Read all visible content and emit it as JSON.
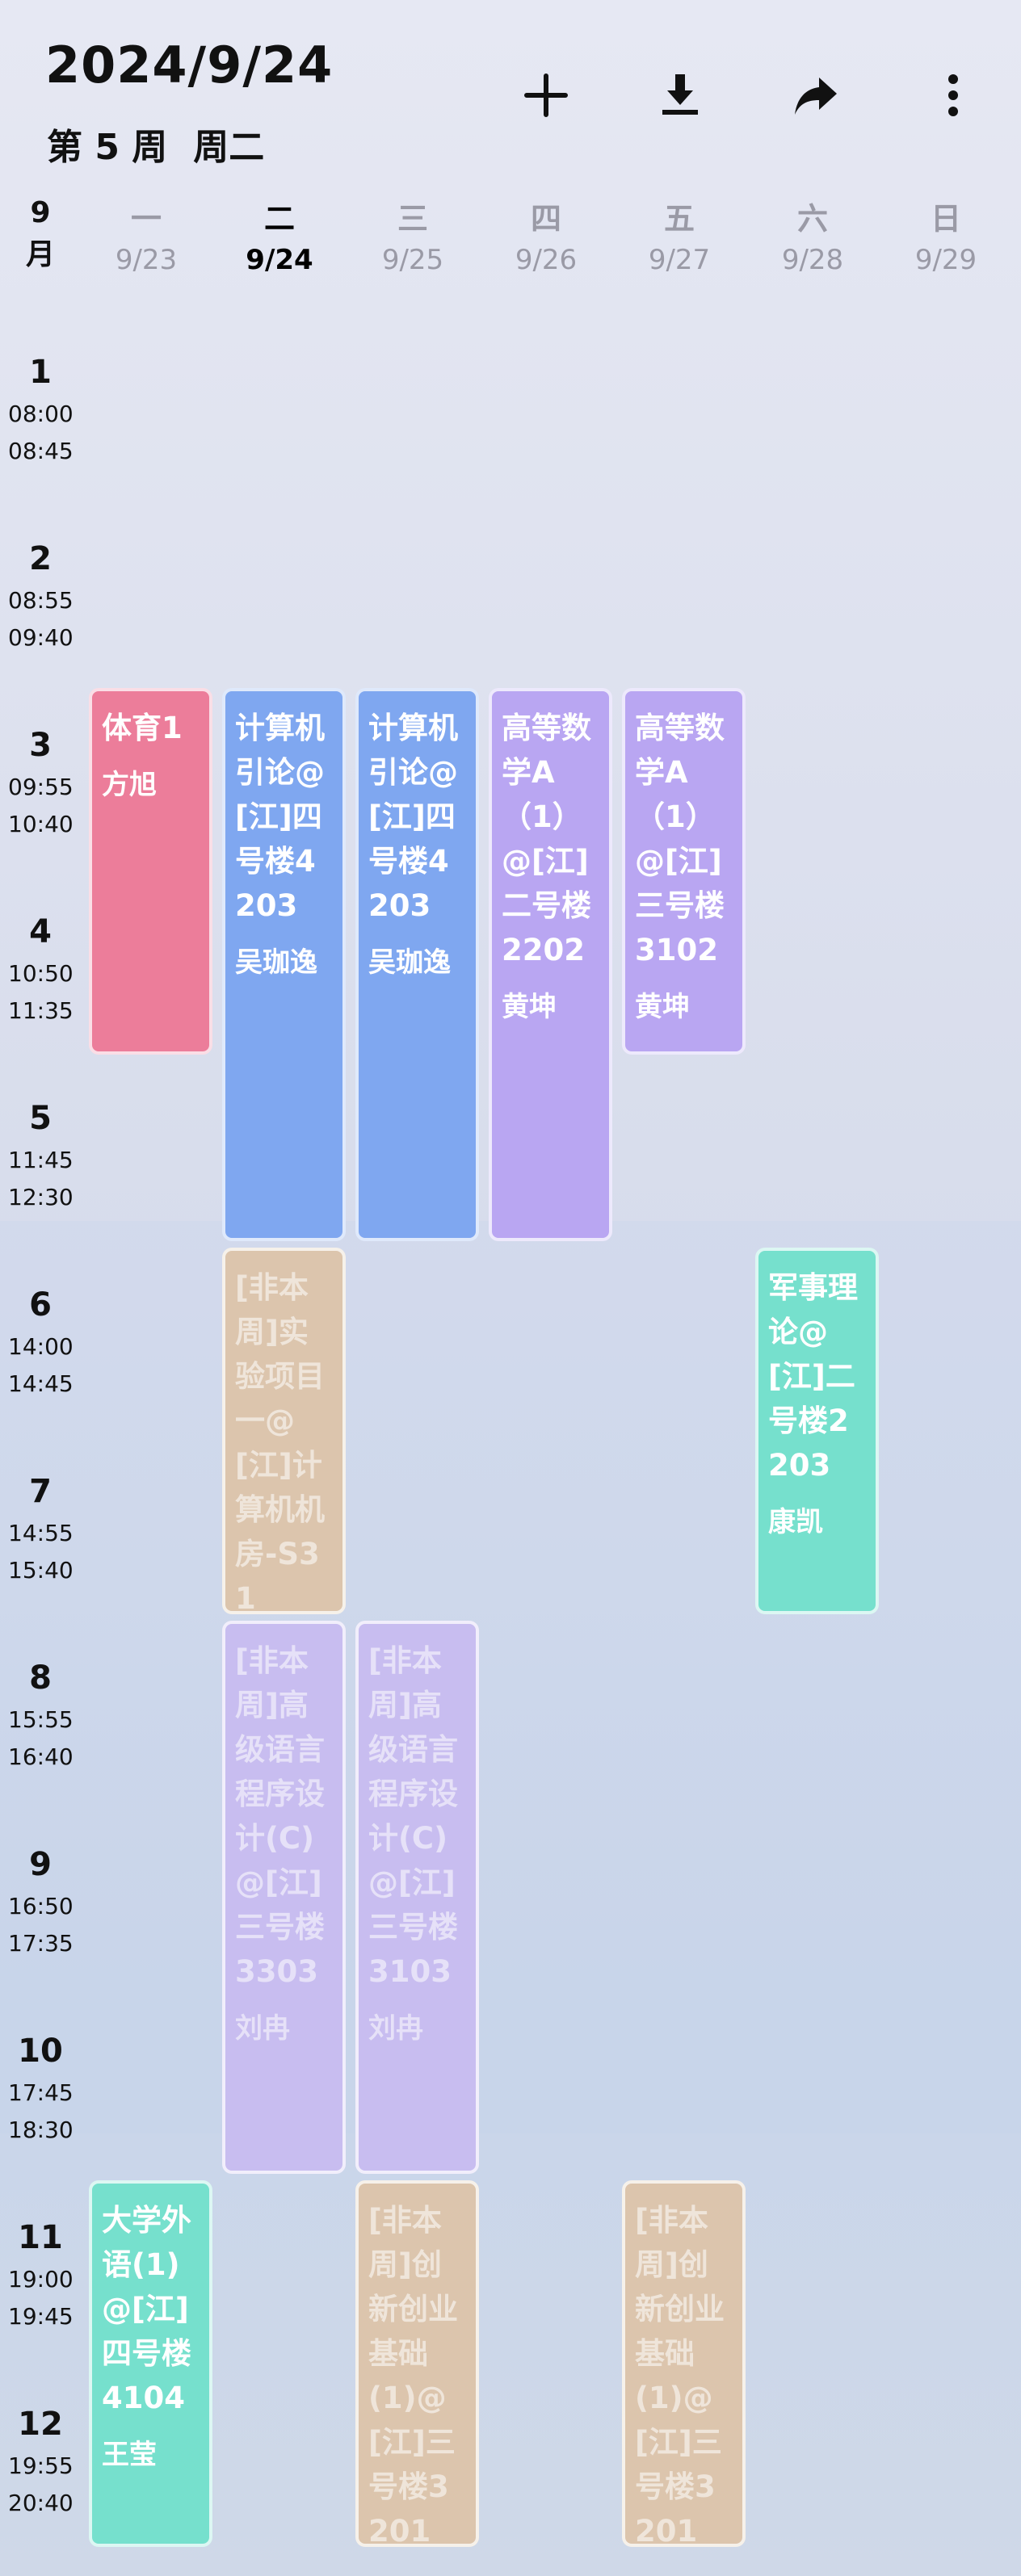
{
  "header": {
    "date": "2024/9/24",
    "week": "第 5 周",
    "weekday": "周二"
  },
  "toolbar": {
    "add_icon": "plus-icon",
    "download_icon": "download-icon",
    "share_icon": "share-icon",
    "more_icon": "more-vertical-icon"
  },
  "calendar": {
    "month_label": "9\n月",
    "days": [
      {
        "weekday": "一",
        "date": "9/23"
      },
      {
        "weekday": "二",
        "date": "9/24",
        "today": true
      },
      {
        "weekday": "三",
        "date": "9/25"
      },
      {
        "weekday": "四",
        "date": "9/26"
      },
      {
        "weekday": "五",
        "date": "9/27"
      },
      {
        "weekday": "六",
        "date": "9/28"
      },
      {
        "weekday": "日",
        "date": "9/29"
      }
    ],
    "periods": [
      {
        "num": "1",
        "start": "08:00",
        "end": "08:45"
      },
      {
        "num": "2",
        "start": "08:55",
        "end": "09:40"
      },
      {
        "num": "3",
        "start": "09:55",
        "end": "10:40"
      },
      {
        "num": "4",
        "start": "10:50",
        "end": "11:35"
      },
      {
        "num": "5",
        "start": "11:45",
        "end": "12:30"
      },
      {
        "num": "6",
        "start": "14:00",
        "end": "14:45"
      },
      {
        "num": "7",
        "start": "14:55",
        "end": "15:40"
      },
      {
        "num": "8",
        "start": "15:55",
        "end": "16:40"
      },
      {
        "num": "9",
        "start": "16:50",
        "end": "17:35"
      },
      {
        "num": "10",
        "start": "17:45",
        "end": "18:30"
      },
      {
        "num": "11",
        "start": "19:00",
        "end": "19:45"
      },
      {
        "num": "12",
        "start": "19:55",
        "end": "20:40"
      }
    ]
  },
  "courses": [
    {
      "day": 0,
      "start": 3,
      "end": 4,
      "name": "体育1",
      "teacher": "方旭",
      "color": "#ec7d9a",
      "current_week": true
    },
    {
      "day": 1,
      "start": 3,
      "end": 5,
      "name": "计算机引论@[江]四号楼4203",
      "teacher": "吴珈逸",
      "color": "#7fa7f0",
      "current_week": true
    },
    {
      "day": 2,
      "start": 3,
      "end": 5,
      "name": "计算机引论@[江]四号楼4203",
      "teacher": "吴珈逸",
      "color": "#7fa7f0",
      "current_week": true
    },
    {
      "day": 3,
      "start": 3,
      "end": 5,
      "name": "高等数学A（1）@[江]二号楼2202",
      "teacher": "黄坤",
      "color": "#b9a6f2",
      "current_week": true
    },
    {
      "day": 4,
      "start": 3,
      "end": 4,
      "name": "高等数学A（1）@[江]三号楼3102",
      "teacher": "黄坤",
      "color": "#b9a6f2",
      "current_week": true
    },
    {
      "day": 1,
      "start": 6,
      "end": 7,
      "name": "[非本周]实验项目一@[江]计算机机房-S31",
      "teacher": "",
      "color": "#dcc5ad",
      "current_week": false
    },
    {
      "day": 5,
      "start": 6,
      "end": 7,
      "name": "军事理论@[江]二号楼2203",
      "teacher": "康凯",
      "color": "#76e0cd",
      "current_week": true
    },
    {
      "day": 1,
      "start": 8,
      "end": 10,
      "name": "[非本周]高级语言程序设计(C)@[江]三号楼3303",
      "teacher": "刘冉",
      "color": "#c8bdf0",
      "current_week": false
    },
    {
      "day": 2,
      "start": 8,
      "end": 10,
      "name": "[非本周]高级语言程序设计(C)@[江]三号楼3103",
      "teacher": "刘冉",
      "color": "#c8bdf0",
      "current_week": false
    },
    {
      "day": 0,
      "start": 11,
      "end": 12,
      "name": "大学外语(1)@[江]四号楼4104",
      "teacher": "王莹",
      "color": "#76e0cd",
      "current_week": true
    },
    {
      "day": 2,
      "start": 11,
      "end": 12,
      "name": "[非本周]创新创业基础(1)@[江]三号楼3201",
      "teacher": "",
      "color": "#dcc5ad",
      "current_week": false
    },
    {
      "day": 4,
      "start": 11,
      "end": 12,
      "name": "[非本周]创新创业基础(1)@[江]三号楼3201",
      "teacher": "",
      "color": "#dcc5ad",
      "current_week": false
    }
  ]
}
